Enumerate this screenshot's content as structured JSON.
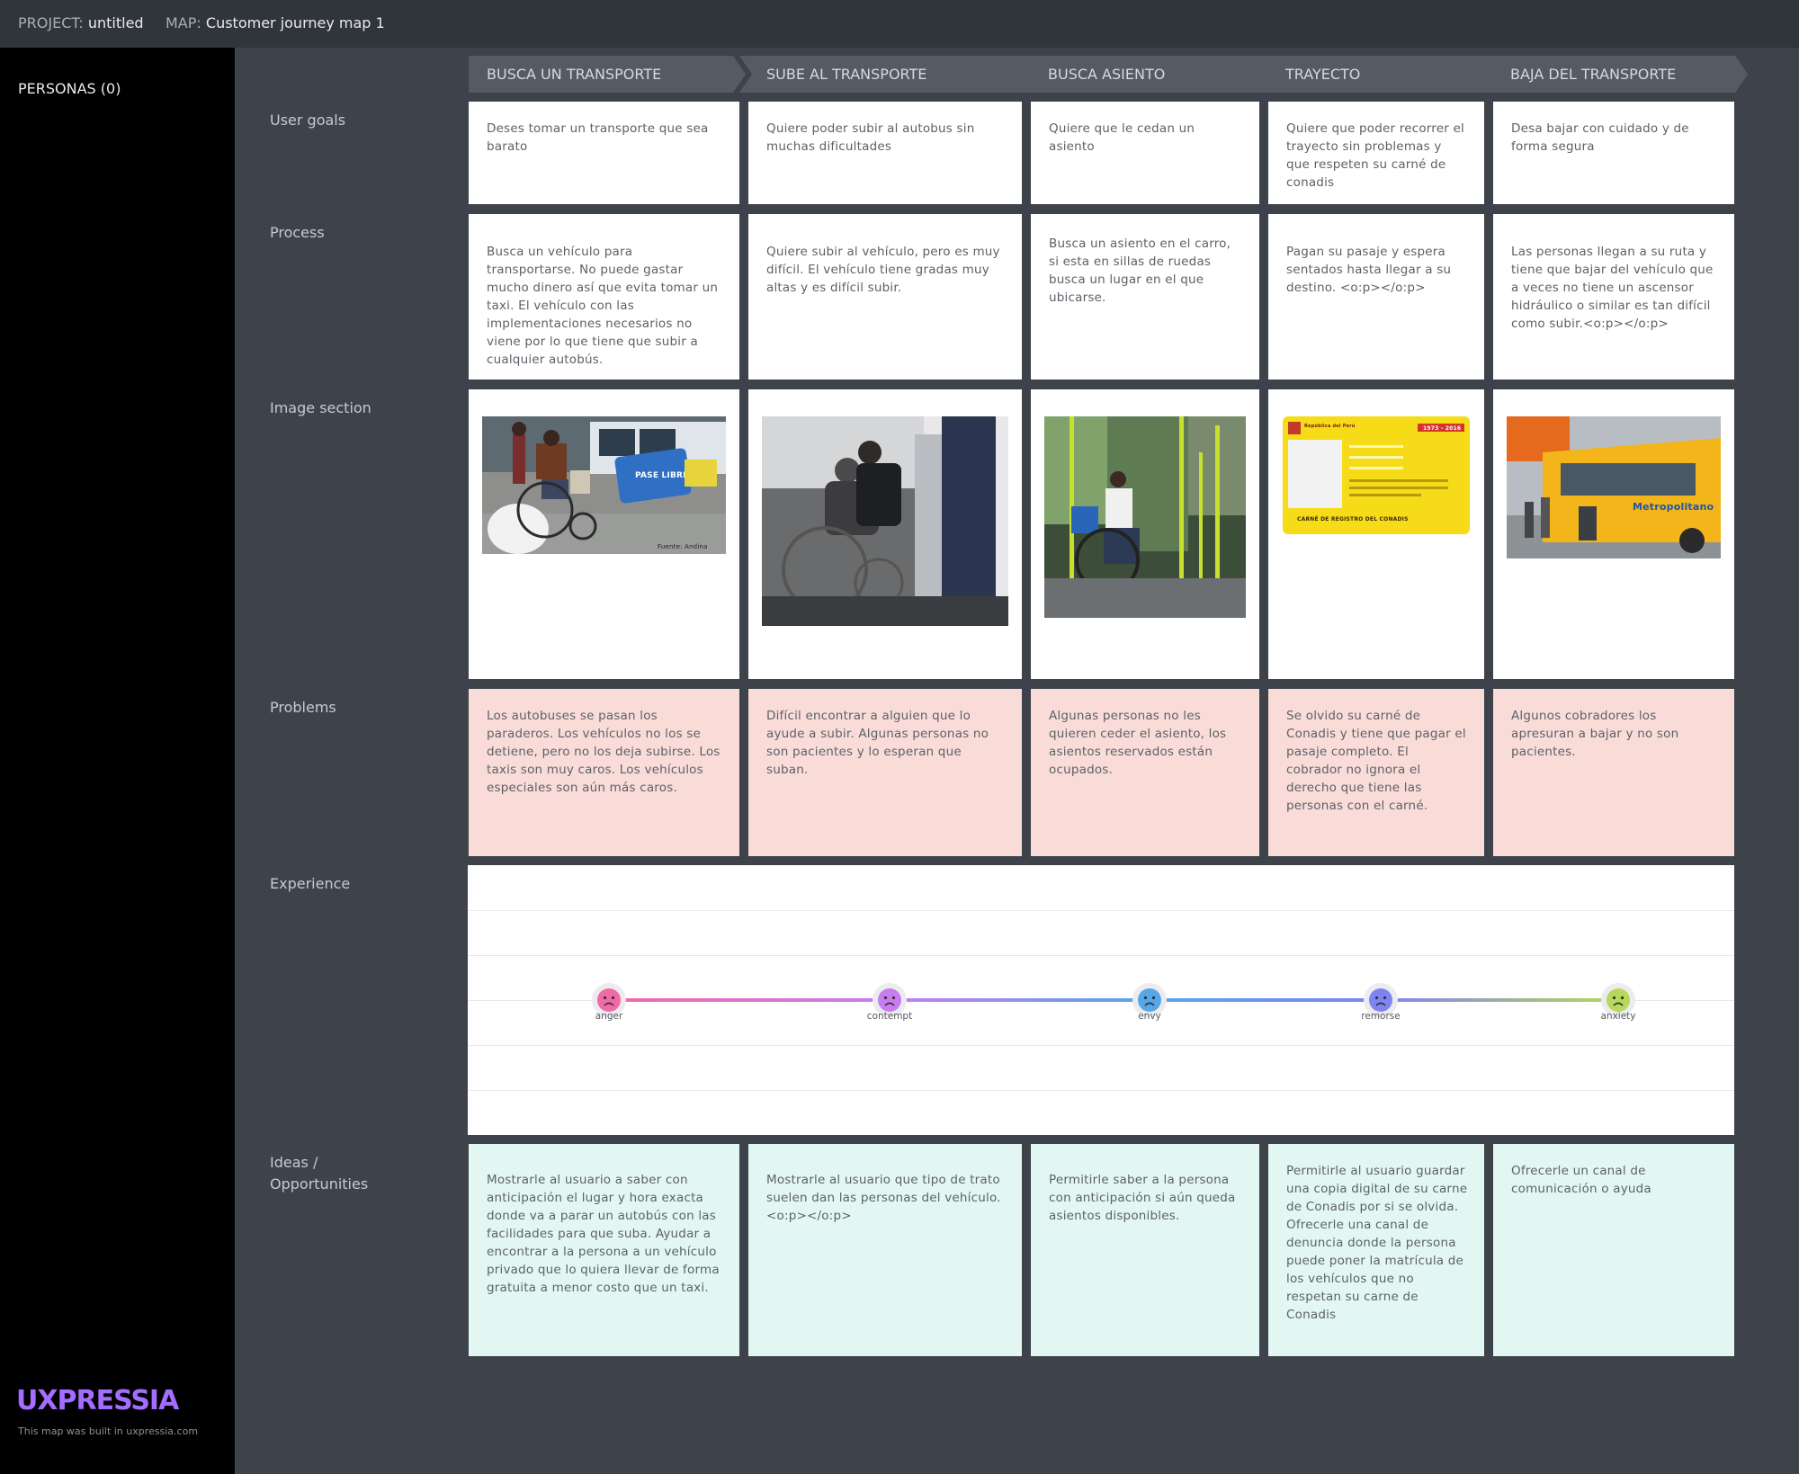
{
  "header": {
    "project_label": "PROJECT:",
    "project_name": "untitled",
    "map_label": "MAP:",
    "map_name": "Customer journey map 1"
  },
  "sidebar": {
    "personas": "PERSONAS (0)",
    "brand": "UXPRESSIA",
    "built": "This map was built in uxpressia.com"
  },
  "rows": {
    "user_goals": "User goals",
    "process": "Process",
    "image_section": "Image section",
    "problems": "Problems",
    "experience": "Experience",
    "ideas": "Ideas / Opportunities"
  },
  "stages": [
    "BUSCA UN TRANSPORTE",
    "SUBE AL TRANSPORTE",
    "BUSCA ASIENTO",
    "TRAYECTO",
    "BAJA DEL TRANSPORTE"
  ],
  "user_goals": [
    "Deses tomar un transporte que sea barato",
    "Quiere poder subir al autobus sin muchas dificultades",
    "Quiere que le cedan un asiento",
    "Quiere que poder recorrer el trayecto sin problemas y que respeten su carné de conadis",
    "Desa bajar con cuidado y de forma segura"
  ],
  "process": [
    "Busca un vehículo para transportarse. No puede gastar mucho dinero así que evita tomar un taxi. El vehículo con las implementaciones necesarios no viene  por lo que tiene que subir a cualquier autobús.",
    "Quiere subir al vehículo, pero es muy difícil. El vehículo tiene gradas muy altas y es difícil subir.",
    "Busca un asiento en el carro, si esta en sillas de ruedas busca un lugar en el que ubicarse.",
    "Pagan su pasaje y espera sentados hasta llegar a su destino. <o:p></o:p>",
    "Las personas llegan a su ruta y tiene que bajar del vehículo que a veces no tiene un ascensor hidráulico o similar es tan difícil como subir.<o:p></o:p>"
  ],
  "images": {
    "credit": "Fuente: Andina",
    "card_title": "CARNÉ DE REGISTRO DEL CONADIS",
    "card_country": "República del Perú",
    "card_years": "1973 - 2016",
    "bus_brand": "Metropolitano",
    "sign_text": "PASE LIBRE"
  },
  "problems": [
    "Los autobuses se pasan los paraderos.  Los vehículos no los se detiene, pero no los deja subirse. Los taxis son muy caros. Los vehículos especiales son aún más caros.",
    "Difícil encontrar a alguien que lo ayude a subir. Algunas personas no son pacientes y lo esperan que suban.",
    "Algunas personas no les quieren ceder el asiento, los asientos reservados están ocupados.",
    "Se olvido su carné de Conadis y tiene que pagar el pasaje completo. El cobrador no ignora el derecho que tiene las personas con el carné.",
    "Algunos cobradores los apresuran a bajar y no son pacientes."
  ],
  "experience": {
    "points": [
      {
        "emotion": "anger",
        "level": 0,
        "color": "#f06aa8"
      },
      {
        "emotion": "contempt",
        "level": 0,
        "color": "#c77df0"
      },
      {
        "emotion": "envy",
        "level": 0,
        "color": "#56a6ea"
      },
      {
        "emotion": "remorse",
        "level": 0,
        "color": "#7f84f2"
      },
      {
        "emotion": "anxiety",
        "level": 0,
        "color": "#b7d85a"
      }
    ]
  },
  "ideas": [
    "Mostrarle al usuario a saber con anticipación el lugar y hora exacta donde va a parar un autobús con las facilidades para que suba. Ayudar a encontrar a la persona a un vehículo privado que lo quiera llevar de forma gratuita a menor costo que un taxi.",
    "Mostrarle al usuario que tipo de trato suelen dan las personas del vehículo. <o:p></o:p>",
    "Permitirle saber a la persona con anticipación si aún queda asientos disponibles.",
    "Permitirle al usuario guardar una copia digital de su carne de Conadis por si se olvida. Ofrecerle una canal de denuncia donde la persona puede poner la matrícula de los vehículos que no respetan su carne de Conadis",
    "Ofrecerle un canal de comunicación o ayuda"
  ]
}
